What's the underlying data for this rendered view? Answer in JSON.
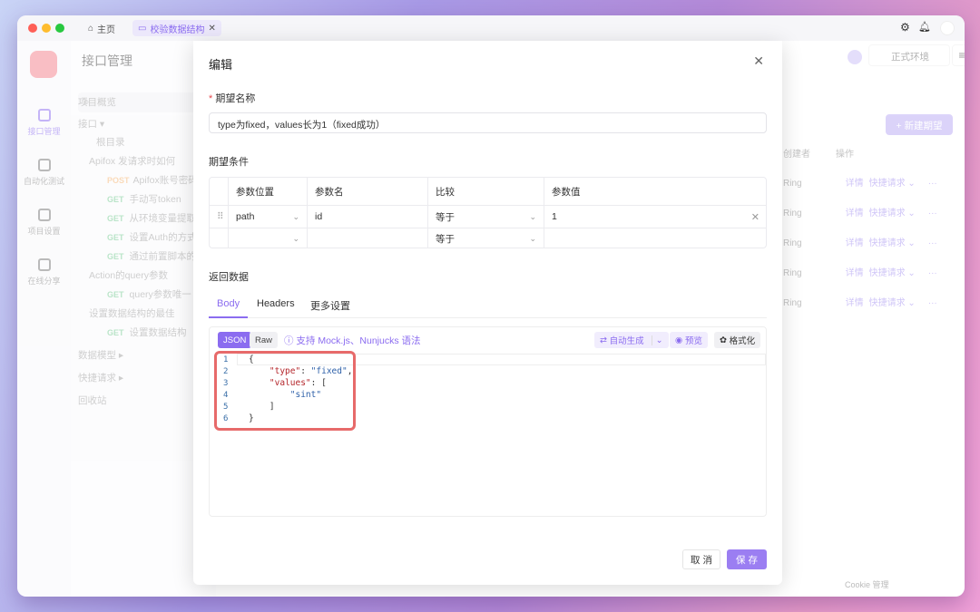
{
  "titlebar": {
    "home": "主页",
    "tab": "校验数据结构"
  },
  "sidebar": [
    {
      "label": "接口管理"
    },
    {
      "label": "自动化测试"
    },
    {
      "label": "项目设置"
    },
    {
      "label": "在线分享"
    }
  ],
  "nav": {
    "title": "接口管理",
    "items": [
      {
        "text": "项目概览",
        "method": ""
      },
      {
        "text": "接口 ▾",
        "method": ""
      },
      {
        "text": "根目录",
        "method": ""
      },
      {
        "text": "Apifox 发请求时如何",
        "method": ""
      },
      {
        "text": "Apifox账号密码",
        "method": "POST"
      },
      {
        "text": "手动写token",
        "method": "GET"
      },
      {
        "text": "从环境变量提取",
        "method": "GET"
      },
      {
        "text": "设置Auth的方式",
        "method": "GET"
      },
      {
        "text": "通过前置脚本的",
        "method": "GET"
      },
      {
        "text": "Action的query参数",
        "method": ""
      },
      {
        "text": "query参数唯一",
        "method": "GET"
      },
      {
        "text": "设置数据结构的最佳",
        "method": ""
      },
      {
        "text": "设置数据结构",
        "method": "GET"
      },
      {
        "text": "数据模型 ▸",
        "method": ""
      },
      {
        "text": "快捷请求 ▸",
        "method": ""
      },
      {
        "text": "回收站",
        "method": ""
      }
    ]
  },
  "right": {
    "env": "正式环境",
    "new_button": "+ 新建期望",
    "col_creator": "创建者",
    "col_ops": "操作",
    "creator": "Ring",
    "detail": "详情",
    "quick": "快捷请求 ⌄",
    "more": "···"
  },
  "footer": {
    "cookie": "Cookie 管理"
  },
  "modal": {
    "title": "编辑",
    "name_label": "期望名称",
    "required": "*",
    "name_value": "type为fixed，values长为1（fixed成功）",
    "cond_label": "期望条件",
    "cond_headers": [
      "参数位置",
      "参数名",
      "比较",
      "参数值"
    ],
    "cond_rows": [
      [
        "path",
        "id",
        "等于",
        "1"
      ],
      [
        "",
        "",
        "等于",
        ""
      ]
    ],
    "resp_label": "返回数据",
    "tabs": [
      "Body",
      "Headers",
      "更多设置"
    ],
    "format_json": "JSON",
    "format_raw": "Raw",
    "mock_hint": "支持 Mock.js、Nunjucks 语法",
    "auto_gen": "自动生成",
    "preview": "预览",
    "beautify": "格式化",
    "code": [
      {
        "n": "1",
        "t": "{"
      },
      {
        "n": "2",
        "t": "    \"type\": \"fixed\","
      },
      {
        "n": "3",
        "t": "    \"values\": ["
      },
      {
        "n": "4",
        "t": "        \"sint\""
      },
      {
        "n": "5",
        "t": "    ]"
      },
      {
        "n": "6",
        "t": "}"
      }
    ],
    "cancel": "取 消",
    "save": "保 存"
  },
  "colors": {
    "accent": "#8b6cf0",
    "highlight": "#e76a6a"
  }
}
